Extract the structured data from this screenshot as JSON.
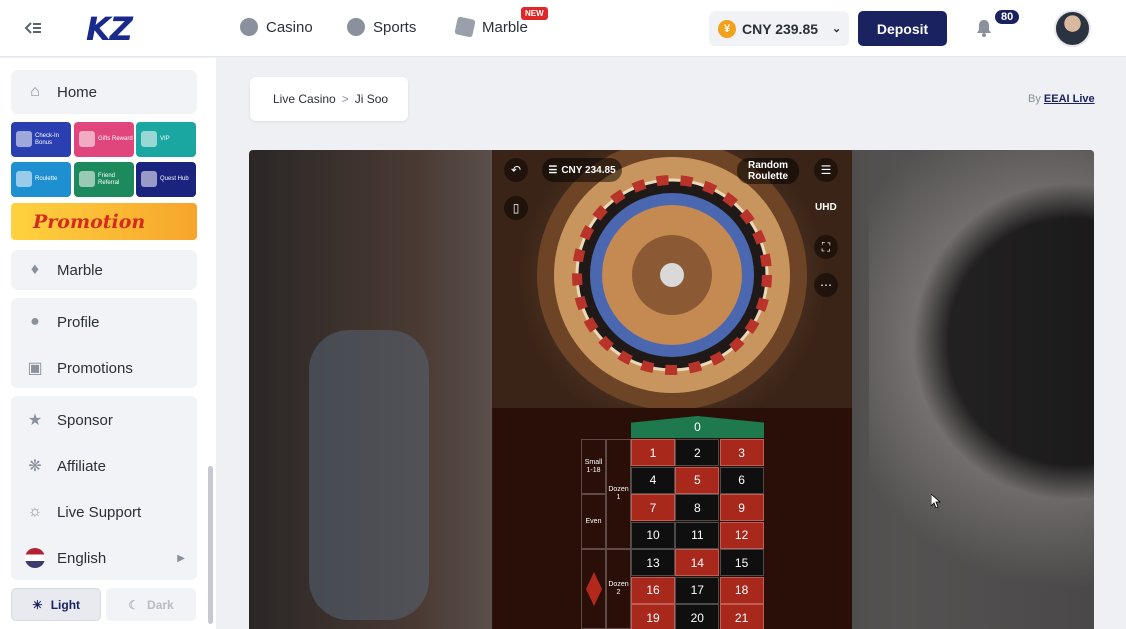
{
  "header": {
    "logo": "KZ",
    "nav": [
      {
        "label": "Casino",
        "icon": "casino-chip-icon"
      },
      {
        "label": "Sports",
        "icon": "soccer-ball-icon"
      },
      {
        "label": "Marble",
        "icon": "marble-icon",
        "badge": "NEW"
      }
    ],
    "balance": {
      "currency_symbol": "¥",
      "amount": "CNY 239.85"
    },
    "deposit_label": "Deposit",
    "notifications_count": "80"
  },
  "sidebar": {
    "home": "Home",
    "tiles": [
      {
        "label": "Check-In Bonus",
        "color": "#2a3fb0"
      },
      {
        "label": "Gifts Reward",
        "color": "#e0457b"
      },
      {
        "label": "VIP",
        "color": "#1aa7a1"
      },
      {
        "label": "Roulette",
        "color": "#1e8fd1"
      },
      {
        "label": "Friend Referral",
        "color": "#1c8a5d"
      },
      {
        "label": "Quest Hub",
        "color": "#1a237e"
      }
    ],
    "promotion_banner": "Promotion",
    "marble": "Marble",
    "profile": "Profile",
    "promotions": "Promotions",
    "sponsor": "Sponsor",
    "affiliate": "Affiliate",
    "live_support": "Live Support",
    "language": "English",
    "theme_light": "Light",
    "theme_dark": "Dark"
  },
  "breadcrumb": {
    "parent": "Live Casino",
    "separator": ">",
    "current": "Ji Soo"
  },
  "provider": {
    "by": "By",
    "name": "EEAI Live"
  },
  "game": {
    "balance": "CNY 234.85",
    "random_roulette": "Random Roulette",
    "quality": "UHD",
    "zero": "0",
    "rows": [
      [
        {
          "n": "1",
          "c": "red"
        },
        {
          "n": "2",
          "c": "black"
        },
        {
          "n": "3",
          "c": "red"
        }
      ],
      [
        {
          "n": "4",
          "c": "black"
        },
        {
          "n": "5",
          "c": "red"
        },
        {
          "n": "6",
          "c": "black"
        }
      ],
      [
        {
          "n": "7",
          "c": "red"
        },
        {
          "n": "8",
          "c": "black"
        },
        {
          "n": "9",
          "c": "red"
        }
      ],
      [
        {
          "n": "10",
          "c": "black"
        },
        {
          "n": "11",
          "c": "black"
        },
        {
          "n": "12",
          "c": "red"
        }
      ],
      [
        {
          "n": "13",
          "c": "black"
        },
        {
          "n": "14",
          "c": "red"
        },
        {
          "n": "15",
          "c": "black"
        }
      ],
      [
        {
          "n": "16",
          "c": "red"
        },
        {
          "n": "17",
          "c": "black"
        },
        {
          "n": "18",
          "c": "red"
        }
      ],
      [
        {
          "n": "19",
          "c": "red"
        },
        {
          "n": "20",
          "c": "black"
        },
        {
          "n": "21",
          "c": "red"
        }
      ]
    ],
    "bets": {
      "small": "Small 1-18",
      "even": "Even",
      "dozen1": "Dozen 1",
      "dozen2": "Dozen 2"
    }
  }
}
